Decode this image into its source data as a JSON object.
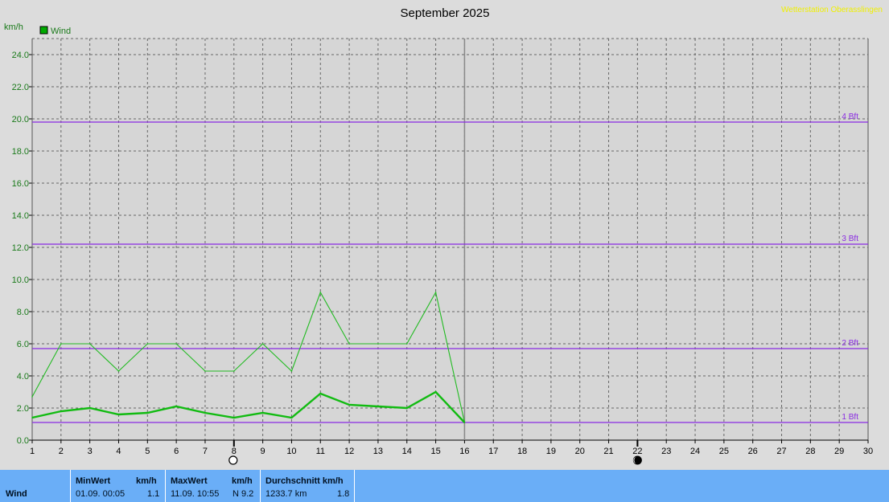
{
  "chart_data": {
    "type": "line",
    "title": "September 2025",
    "station": "Wetterstation Oberasslingen",
    "ylabel": "km/h",
    "legend": [
      {
        "label": "Wind",
        "color": "#00aa00"
      }
    ],
    "x": [
      1,
      2,
      3,
      4,
      5,
      6,
      7,
      8,
      9,
      10,
      11,
      12,
      13,
      14,
      15,
      16
    ],
    "xlim": [
      1,
      30
    ],
    "x_ticks": [
      "1",
      "2",
      "3",
      "4",
      "5",
      "6",
      "7",
      "8",
      "9",
      "10",
      "11",
      "12",
      "13",
      "14",
      "15",
      "16",
      "17",
      "18",
      "19",
      "20",
      "21",
      "22",
      "23",
      "24",
      "25",
      "26",
      "27",
      "28",
      "29",
      "30"
    ],
    "ylim": [
      0,
      25
    ],
    "y_ticks": [
      "0.0",
      "2.0",
      "4.0",
      "6.0",
      "8.0",
      "10.0",
      "12.0",
      "14.0",
      "16.0",
      "18.0",
      "20.0",
      "22.0",
      "24.0"
    ],
    "series": [
      {
        "name": "Wind",
        "style": "max",
        "color": "#22bb22",
        "values": [
          2.7,
          6.0,
          6.0,
          4.3,
          6.0,
          6.0,
          4.3,
          4.3,
          6.0,
          4.3,
          9.2,
          6.0,
          6.0,
          6.0,
          9.2,
          1.1
        ]
      },
      {
        "name": "Wind",
        "style": "average",
        "color": "#11bb11",
        "values": [
          1.4,
          1.8,
          2.0,
          1.6,
          1.7,
          2.1,
          1.7,
          1.4,
          1.7,
          1.4,
          2.9,
          2.2,
          2.1,
          2.0,
          3.0,
          1.1
        ]
      }
    ],
    "reference_lines": [
      {
        "label": "1 Bft",
        "y": 1.1
      },
      {
        "label": "2 Bft",
        "y": 5.7
      },
      {
        "label": "3 Bft",
        "y": 12.2
      },
      {
        "label": "4 Bft",
        "y": 19.8
      }
    ],
    "current_day": 16,
    "moon_phases": [
      {
        "day": 8,
        "phase": "full-moon-icon"
      },
      {
        "day": 22,
        "phase": "new-moon-icon"
      }
    ],
    "colors": {
      "grid": "#666666",
      "bft": "#8a2be2",
      "axis_text": "#1a7a1a",
      "station": "#f0f000"
    }
  },
  "summary": {
    "row_label": "Wind",
    "min": {
      "header": "MinWert",
      "unit": "km/h",
      "datetime": "01.09.  00:05",
      "value": "1.1"
    },
    "max": {
      "header": "MaxWert",
      "unit": "km/h",
      "datetime": "11.09.  10:55",
      "value": "N 9.2"
    },
    "avg": {
      "header": "Durchschnitt km/h",
      "distance": "1233.7 km",
      "value": "1.8"
    }
  }
}
